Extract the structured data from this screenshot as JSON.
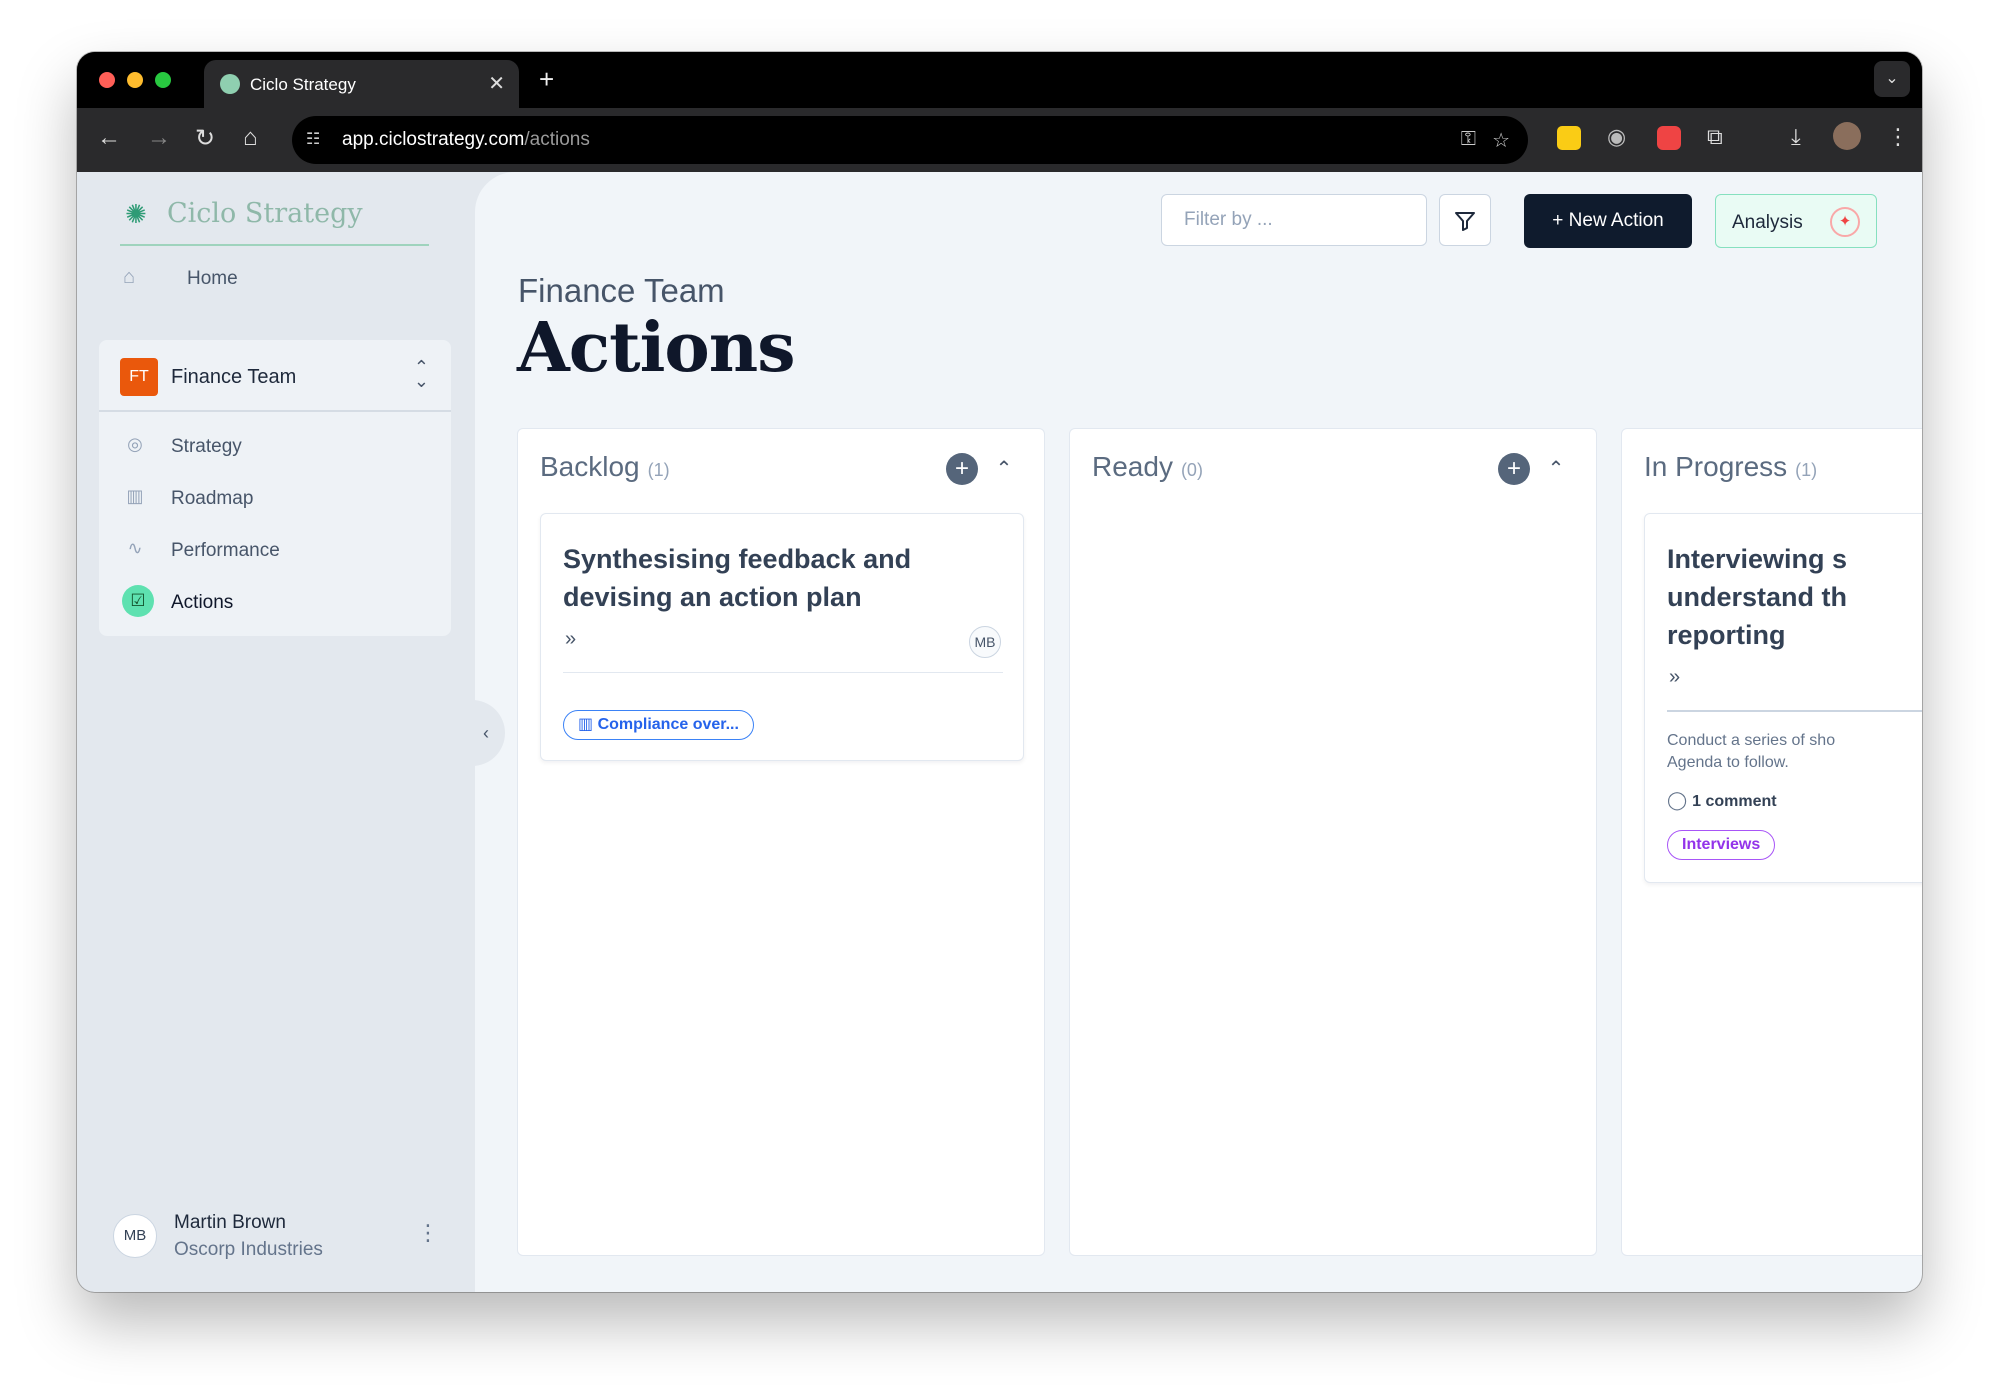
{
  "browser": {
    "tab_title": "Ciclo Strategy",
    "url_host": "app.ciclostrategy.com",
    "url_path": "/actions"
  },
  "sidebar": {
    "brand": "Ciclo Strategy",
    "home": "Home",
    "team": {
      "badge": "FT",
      "name": "Finance Team"
    },
    "items": [
      {
        "label": "Strategy",
        "icon": "compass-icon"
      },
      {
        "label": "Roadmap",
        "icon": "map-icon"
      },
      {
        "label": "Performance",
        "icon": "activity-icon"
      },
      {
        "label": "Actions",
        "icon": "check-square-icon",
        "active": true
      }
    ],
    "user": {
      "initials": "MB",
      "name": "Martin Brown",
      "company": "Oscorp Industries"
    }
  },
  "toolbar": {
    "filter_placeholder": "Filter by ...",
    "new_action": "+ New Action",
    "analysis": "Analysis"
  },
  "page": {
    "subtitle": "Finance Team",
    "title": "Actions"
  },
  "columns": [
    {
      "title": "Backlog",
      "count": "(1)",
      "cards": [
        {
          "title": "Synthesising feedback and devising an action plan",
          "assignee": "MB",
          "tag": "Compliance over..."
        }
      ]
    },
    {
      "title": "Ready",
      "count": "(0)",
      "cards": []
    },
    {
      "title": "In Progress",
      "count": "(1)",
      "cards": [
        {
          "title": "Interviewing s understand th reporting",
          "title_lines": [
            "Interviewing s",
            "understand th",
            "reporting"
          ],
          "desc_lines": [
            "Conduct a series of sho",
            "Agenda to follow."
          ],
          "comments": "1 comment",
          "tag": "Interviews"
        }
      ]
    }
  ],
  "colors": {
    "accent_dark": "#0f1b2d",
    "brand_green": "#5ee1b0",
    "team_badge": "#ea580c"
  }
}
